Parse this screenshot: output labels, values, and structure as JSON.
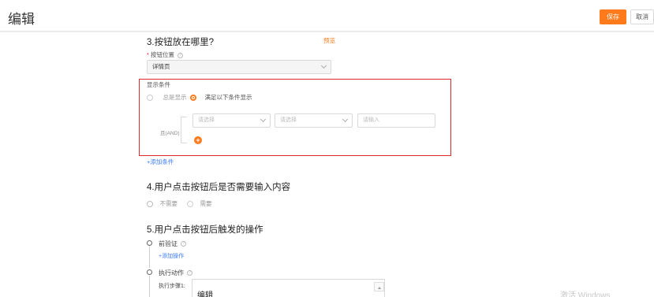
{
  "header": {
    "title": "编辑",
    "save_label": "保存",
    "cancel_label": "取消"
  },
  "section3": {
    "heading": "3.按钮放在哪里?",
    "preview_label": "预览",
    "position_label": "按钮位置",
    "position_value": "详情页",
    "display_condition_label": "显示条件",
    "radio_always": "总是显示",
    "radio_conditional": "满足以下条件显示",
    "and_label": "且(AND)",
    "select1_placeholder": "请选择",
    "select2_placeholder": "请选择",
    "input_placeholder": "请输入",
    "add_condition": "+添加条件"
  },
  "section4": {
    "heading": "4.用户点击按钮后是否需要输入内容",
    "option_no": "不需要",
    "option_yes": "需要"
  },
  "section5": {
    "heading": "5.用户点击按钮后触发的操作",
    "pre_validation": "前验证",
    "add_operation": "+添加操作",
    "execute_action": "执行动作",
    "step1_label": "执行步骤1:",
    "step1_value": "编辑"
  },
  "watermark": "激活 Windows",
  "colors": {
    "accent": "#ff7a1a",
    "highlight_border": "#e0282e",
    "link": "#3b7cff"
  }
}
